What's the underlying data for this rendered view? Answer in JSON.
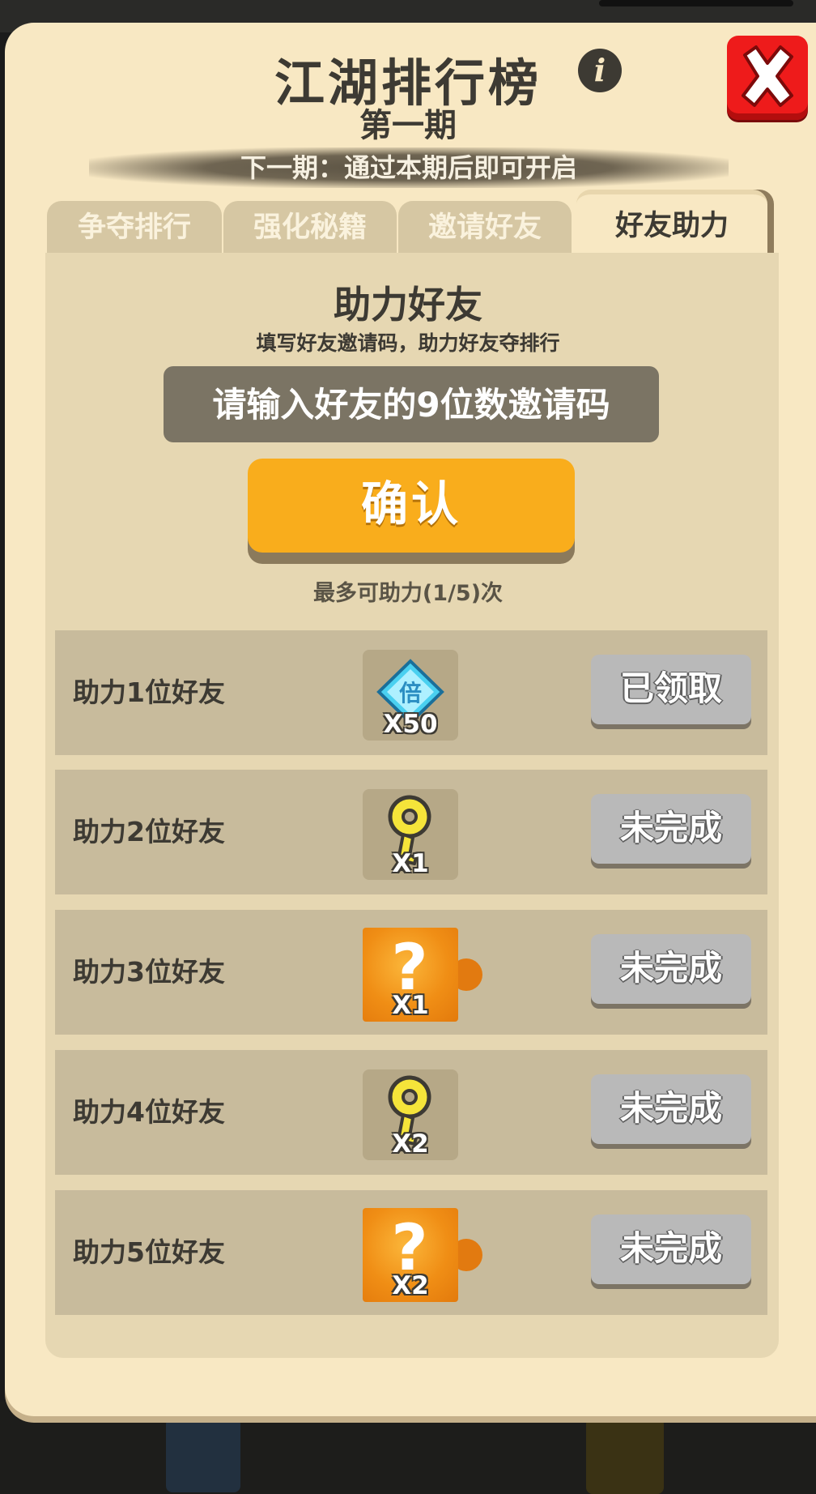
{
  "header": {
    "title": "江湖排行榜",
    "period": "第一期",
    "next_period_note": "下一期：通过本期后即可开启"
  },
  "tabs": [
    {
      "label": "争夺排行",
      "active": false
    },
    {
      "label": "强化秘籍",
      "active": false
    },
    {
      "label": "邀请好友",
      "active": false
    },
    {
      "label": "好友助力",
      "active": true
    }
  ],
  "assist": {
    "title": "助力好友",
    "description": "填写好友邀请码，助力好友夺排行",
    "input_placeholder": "请输入好友的9位数邀请码",
    "confirm_label": "确认",
    "limit_text": "最多可助力(1/5)次"
  },
  "rewards": [
    {
      "label": "助力1位好友",
      "item_icon": "double-diamond-icon",
      "count": "X50",
      "status": "已领取"
    },
    {
      "label": "助力2位好友",
      "item_icon": "gold-key-icon",
      "count": "X1",
      "status": "未完成"
    },
    {
      "label": "助力3位好友",
      "item_icon": "mystery-puzzle-icon",
      "count": "X1",
      "status": "未完成"
    },
    {
      "label": "助力4位好友",
      "item_icon": "gold-key-icon",
      "count": "X2",
      "status": "未完成"
    },
    {
      "label": "助力5位好友",
      "item_icon": "mystery-puzzle-icon",
      "count": "X2",
      "status": "未完成"
    }
  ],
  "colors": {
    "panel_bg": "#f8e8c3",
    "confirm_button": "#f9ad1c",
    "close_button": "#ee1b1b",
    "status_button": "#b9b9b9"
  }
}
